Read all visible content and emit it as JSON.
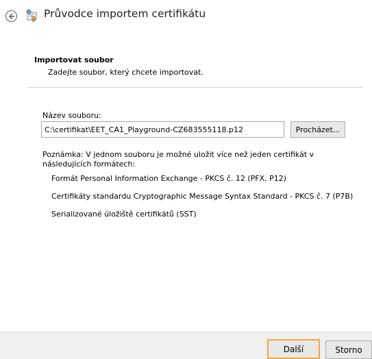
{
  "wizard": {
    "title": "Průvodce importem certifikátu"
  },
  "section": {
    "title": "Importovat soubor",
    "subtitle": "Zadejte soubor, který chcete importovat."
  },
  "file": {
    "label": "Název souboru:",
    "value": "C:\\certifikat\\EET_CA1_Playground-CZ683555118.p12",
    "browse_label": "Procházet..."
  },
  "note": {
    "text": "Poznámka: V jednom souboru je možné uložit více než jeden certifikát v následujících formátech:",
    "formats": [
      "Formát Personal Information Exchange - PKCS č. 12 (PFX, P12)",
      "Certifikáty standardu Cryptographic Message Syntax Standard - PKCS č. 7 (P7B)",
      "Serializované úložiště certifikátů (SST)"
    ]
  },
  "footer": {
    "next_label": "Další",
    "cancel_label": "Storno"
  },
  "colors": {
    "focus_border": "#f3a63b",
    "footer_bg": "#f0f0f0",
    "button_bg": "#e8e8e8"
  }
}
